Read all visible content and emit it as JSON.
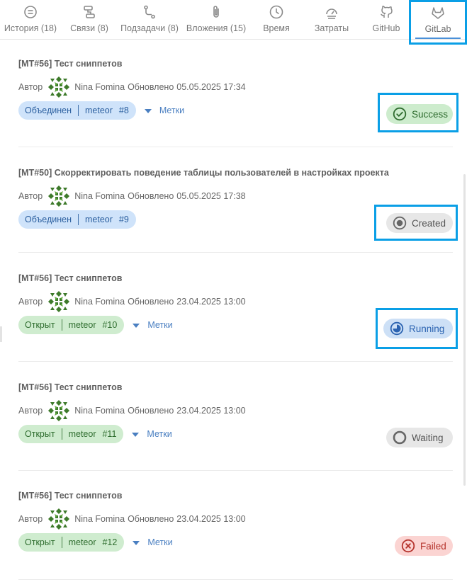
{
  "tabs": [
    {
      "label": "История (18)",
      "icon": "history-icon"
    },
    {
      "label": "Связи (8)",
      "icon": "links-icon"
    },
    {
      "label": "Подзадачи (8)",
      "icon": "subtasks-icon"
    },
    {
      "label": "Вложения (15)",
      "icon": "attachment-icon"
    },
    {
      "label": "Время",
      "icon": "clock-icon"
    },
    {
      "label": "Затраты",
      "icon": "costs-icon"
    },
    {
      "label": "GitHub",
      "icon": "github-icon"
    },
    {
      "label": "GitLab",
      "icon": "gitlab-icon",
      "active": true
    }
  ],
  "common": {
    "author_label": "Автор",
    "updated_label": "Обновлено",
    "labels_button": "Метки"
  },
  "merge_requests": [
    {
      "title": "[MT#56] Тест сниппетов",
      "author": "Nina Fomina",
      "updated": "05.05.2025 17:34",
      "state": "Объединен",
      "state_kind": "merged",
      "branch": "meteor",
      "number": "#8",
      "show_labels": true,
      "status": "Success",
      "status_kind": "success",
      "highlighted": true
    },
    {
      "title": "[MT#50] Скорректировать поведение таблицы пользователей в настройках проекта",
      "author": "Nina Fomina",
      "updated": "05.05.2025 17:38",
      "state": "Объединен",
      "state_kind": "merged",
      "branch": "meteor",
      "number": "#9",
      "show_labels": false,
      "status": "Created",
      "status_kind": "created",
      "highlighted": true
    },
    {
      "title": "[MT#56] Тест сниппетов",
      "author": "Nina Fomina",
      "updated": "23.04.2025 13:00",
      "state": "Открыт",
      "state_kind": "open",
      "branch": "meteor",
      "number": "#10",
      "show_labels": true,
      "status": "Running",
      "status_kind": "running",
      "highlighted": true
    },
    {
      "title": "[MT#56] Тест сниппетов",
      "author": "Nina Fomina",
      "updated": "23.04.2025 13:00",
      "state": "Открыт",
      "state_kind": "open",
      "branch": "meteor",
      "number": "#11",
      "show_labels": true,
      "status": "Waiting",
      "status_kind": "waiting",
      "highlighted": false
    },
    {
      "title": "[MT#56] Тест сниппетов",
      "author": "Nina Fomina",
      "updated": "23.04.2025 13:00",
      "state": "Открыт",
      "state_kind": "open",
      "branch": "meteor",
      "number": "#12",
      "show_labels": true,
      "status": "Failed",
      "status_kind": "failed",
      "highlighted": false
    }
  ],
  "colors": {
    "highlight": "#0a9fe6",
    "success": "#2e6b2e",
    "running": "#2b63b1",
    "failed": "#b5332c",
    "link": "#4a7fc1"
  }
}
